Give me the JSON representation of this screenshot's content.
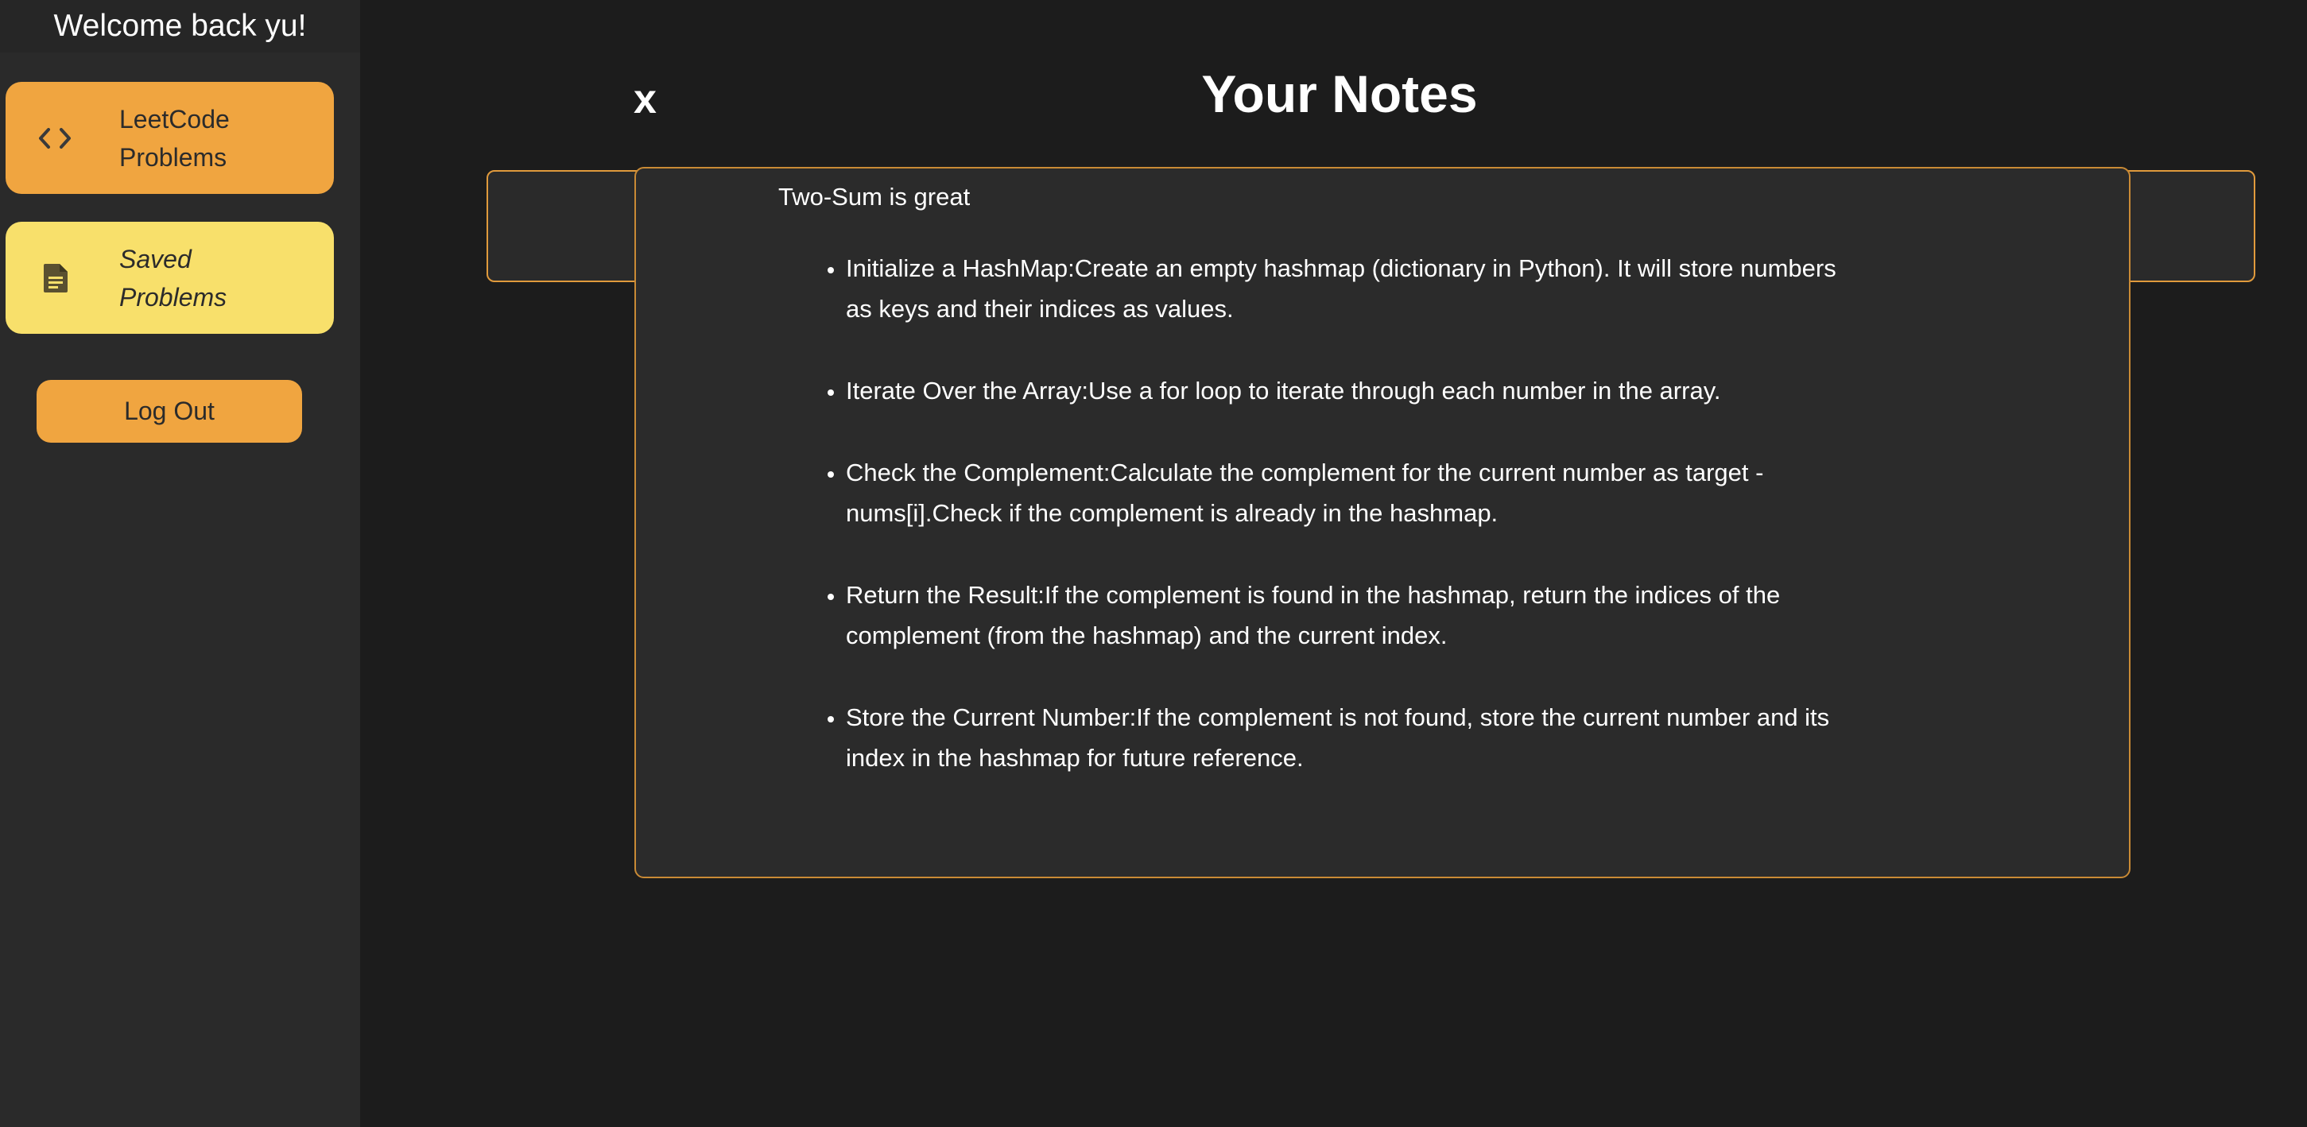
{
  "sidebar": {
    "welcome": "Welcome back yu!",
    "nav": [
      {
        "label": "LeetCode Problems",
        "icon": "code-icon"
      },
      {
        "label": "Saved Problems",
        "icon": "document-icon"
      }
    ],
    "logout_label": "Log Out"
  },
  "main": {
    "close_label": "x",
    "title": "Your Notes",
    "note": {
      "title": "Two-Sum is great",
      "items": [
        "Initialize a HashMap:Create an empty hashmap (dictionary in Python). It will store numbers as keys and their indices as values.",
        "Iterate Over the Array:Use a for loop to iterate through each number in the array.",
        "Check the Complement:Calculate the complement for the current number as target - nums[i].Check if the complement is already in the hashmap.",
        "Return the Result:If the complement is found in the hashmap, return the indices of the complement (from the hashmap) and the current index.",
        "Store the Current Number:If the complement is not found, store the current number and its index in the hashmap for future reference."
      ]
    }
  },
  "colors": {
    "accent_orange": "#f0a540",
    "accent_yellow": "#f8e06b",
    "background": "#1c1c1c",
    "sidebar": "#2a2a2a",
    "card_border": "#c98a35"
  }
}
